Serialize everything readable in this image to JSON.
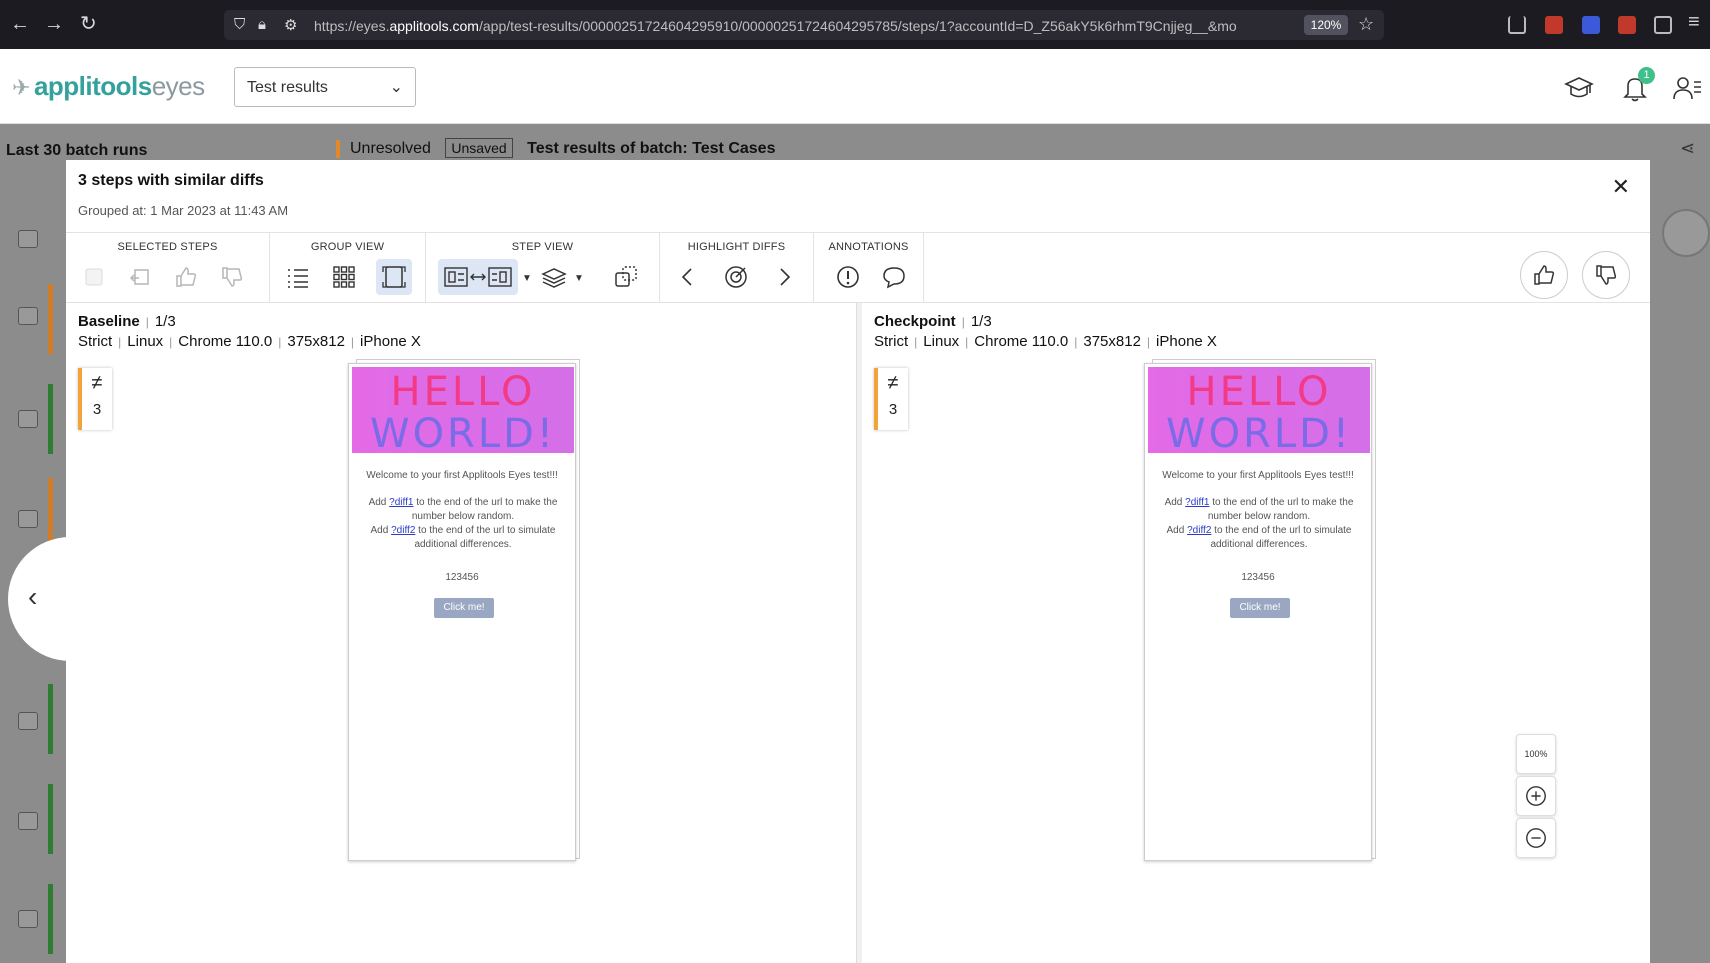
{
  "browser": {
    "url_prefix": "https://eyes.",
    "url_domain": "applitools.com",
    "url_rest": "/app/test-results/00000251724604295910/00000251724604295785/steps/1?accountId=D_Z56akY5k6rhmT9Cnjjeg__&mo",
    "zoom": "120%"
  },
  "header": {
    "logo_main": "applitools",
    "logo_sub": "eyes",
    "select_label": "Test results",
    "notification_count": "1"
  },
  "background": {
    "left_title": "Last 30 batch runs",
    "status": "Unresolved",
    "unsaved": "Unsaved",
    "batch_title": "Test results of batch:  Test Cases"
  },
  "modal": {
    "title": "3 steps with similar diffs",
    "subtitle": "Grouped at: 1 Mar 2023 at 11:43 AM",
    "toolbar_groups": [
      "SELECTED STEPS",
      "GROUP VIEW",
      "STEP VIEW",
      "HIGHLIGHT DIFFS",
      "ANNOTATIONS"
    ]
  },
  "baseline": {
    "label": "Baseline",
    "index": "1/3",
    "meta": [
      "Strict",
      "Linux",
      "Chrome 110.0",
      "375x812",
      "iPhone X"
    ],
    "diff_count": "3"
  },
  "checkpoint": {
    "label": "Checkpoint",
    "index": "1/3",
    "meta": [
      "Strict",
      "Linux",
      "Chrome 110.0",
      "375x812",
      "iPhone X"
    ],
    "diff_count": "3"
  },
  "screenshot": {
    "hello_line1": "HELLO",
    "hello_line2": "WORLD!",
    "welcome": "Welcome to your first Applitools Eyes test!!!",
    "add1_pre": "Add ",
    "add1_link": "?diff1",
    "add1_post": " to the end of the url to make the number below random.",
    "add2_pre": "Add ",
    "add2_link": "?diff2",
    "add2_post": " to the end of the url to simulate additional differences.",
    "number": "123456",
    "button": "Click me!"
  },
  "zoom_controls": {
    "fit_label": "100%"
  },
  "colors": {
    "accent": "#35a19c",
    "diff_marker": "#f2a33a",
    "active_btn": "#dde6f5"
  }
}
